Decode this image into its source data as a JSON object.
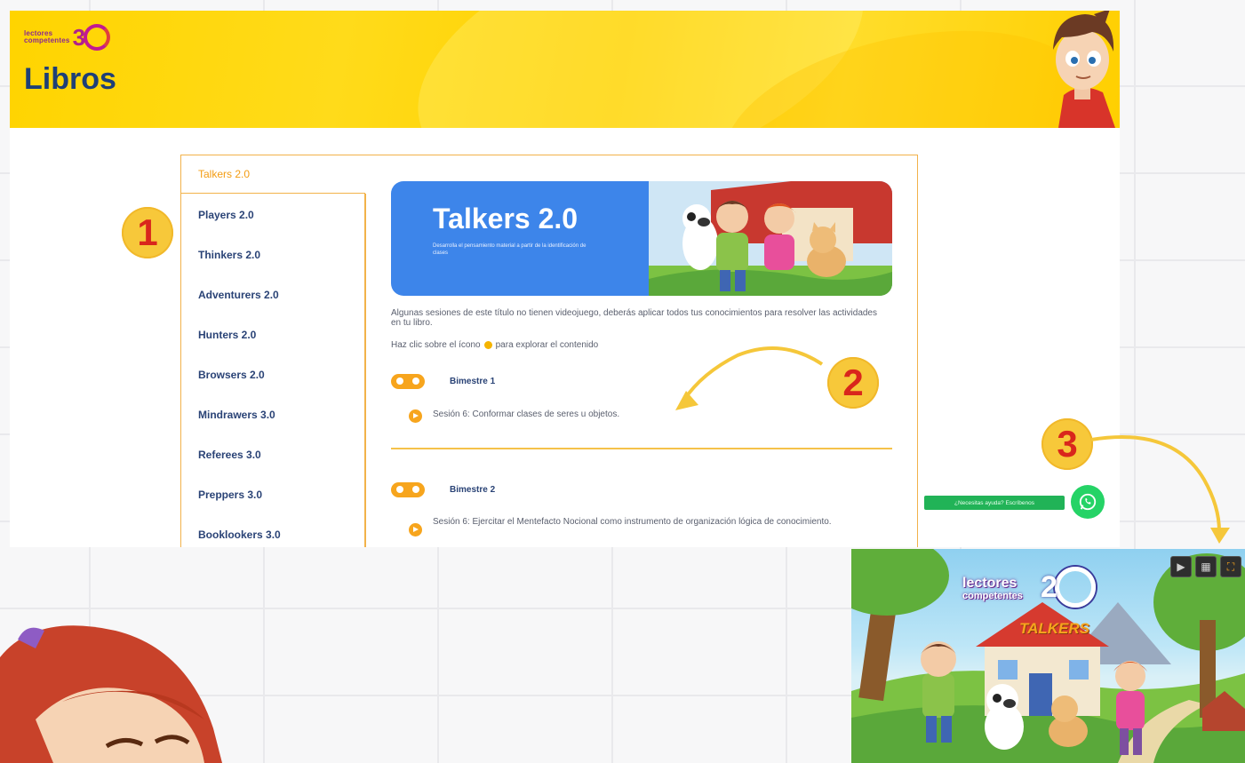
{
  "brand": {
    "word1": "lectores",
    "word2": "competentes",
    "number": "3"
  },
  "hero": {
    "title": "Libros"
  },
  "sidebar": {
    "items": [
      {
        "label": "Talkers 2.0",
        "active": true
      },
      {
        "label": "Players 2.0"
      },
      {
        "label": "Thinkers 2.0"
      },
      {
        "label": "Adventurers 2.0"
      },
      {
        "label": "Hunters 2.0"
      },
      {
        "label": "Browsers 2.0"
      },
      {
        "label": "Mindrawers 3.0"
      },
      {
        "label": "Referees 3.0"
      },
      {
        "label": "Preppers 3.0"
      },
      {
        "label": "Booklookers 3.0"
      }
    ]
  },
  "book": {
    "title": "Talkers 2.0",
    "subtitle": "Desarrolla el pensamiento material a partir de la identificación de clases",
    "intro": "Algunas sesiones de este título no tienen videojuego, deberás aplicar todos tus conocimientos para resolver las actividades en tu libro.",
    "hint_before": "Haz clic sobre el ícono",
    "hint_after": "para explorar el contenido"
  },
  "terms": [
    {
      "label": "Bimestre 1",
      "session": "Sesión 6: Conformar clases de seres u objetos."
    },
    {
      "label": "Bimestre 2",
      "session": "Sesión 6: Ejercitar el Mentefacto Nocional como instrumento de organización lógica de conocimiento."
    }
  ],
  "badges": {
    "one": "1",
    "two": "2",
    "three": "3"
  },
  "whatsapp": {
    "label": "¿Necesitas ayuda? Escríbenos"
  },
  "game": {
    "logo_line1": "lectores",
    "logo_line2": "competentes",
    "logo_number": "2",
    "logo_title": "TALKERS"
  },
  "colors": {
    "hero_yellow": "#ffd400",
    "navy": "#1e3f77",
    "accent_orange": "#f7a51d",
    "book_blue": "#3d85ea",
    "whatsapp_green": "#25d366",
    "badge_yellow": "#f7c83a",
    "badge_red": "#d9261c"
  }
}
